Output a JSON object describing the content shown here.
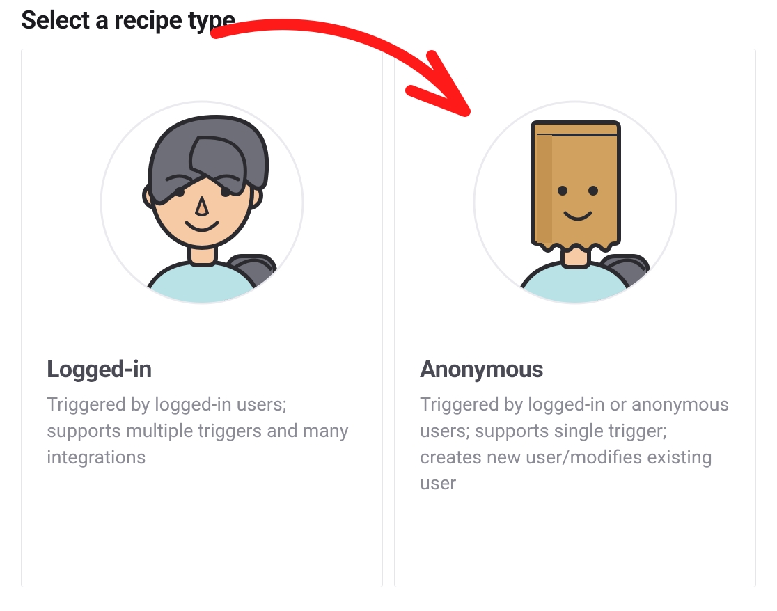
{
  "page_title": "Select a recipe type",
  "cards": [
    {
      "title": "Logged-in",
      "description": "Triggered by logged-in users; supports multiple triggers and many integrations"
    },
    {
      "title": "Anonymous",
      "description": "Triggered by logged-in or anonymous users; supports single trigger; creates new user/modifies existing user"
    }
  ],
  "annotation": {
    "type": "arrow",
    "color": "#ff1a1a",
    "target": "anonymous-card"
  }
}
